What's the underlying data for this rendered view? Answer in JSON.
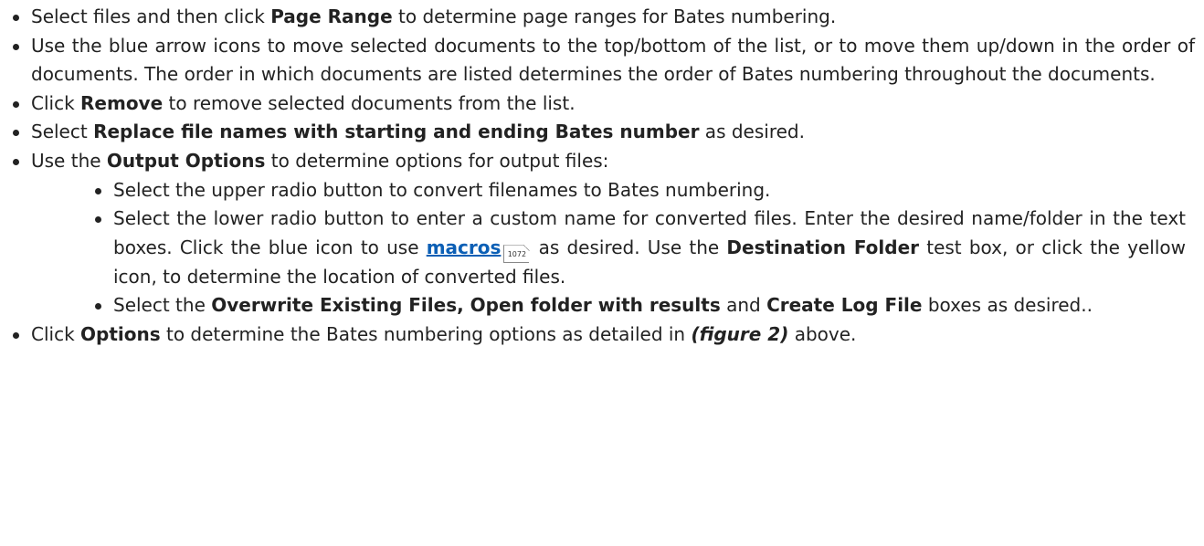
{
  "items": [
    {
      "pre": "Select files and then click ",
      "bold": "Page Range",
      "post": " to determine page ranges for Bates numbering."
    },
    {
      "text": "Use the blue arrow icons to move selected documents to the top/bottom of the list, or to move them up/down in the order of documents. The order in which documents are listed determines the order of Bates numbering throughout the documents."
    },
    {
      "pre": "Click ",
      "bold": "Remove",
      "post": " to remove selected documents from the list."
    },
    {
      "pre": "Select ",
      "bold": "Replace file names with starting and ending Bates number",
      "post": " as desired."
    },
    {
      "pre": "Use the ",
      "bold": "Output Options",
      "post": " to determine options for output files:"
    }
  ],
  "subitems": [
    {
      "text": "Select the upper radio button to convert filenames to Bates numbering."
    },
    {
      "pre": "Select the lower radio button to enter a custom name for converted files. Enter the desired name/folder in the text boxes. Click the blue icon to use ",
      "link": "macros",
      "page_ref": "1072",
      "mid": " as desired. Use the ",
      "bold": "Destination Folder",
      "post": " test box, or click the yellow icon, to determine the location of converted files."
    },
    {
      "pre": "Select the ",
      "bold1": "Overwrite Existing Files, Open folder with results",
      "mid": " and ",
      "bold2": "Create Log File",
      "post": " boxes as desired.."
    }
  ],
  "last": {
    "pre": "Click ",
    "bold": "Options",
    "mid": " to determine the Bates numbering options as detailed in ",
    "emph": "(figure 2)",
    "post": " above."
  }
}
